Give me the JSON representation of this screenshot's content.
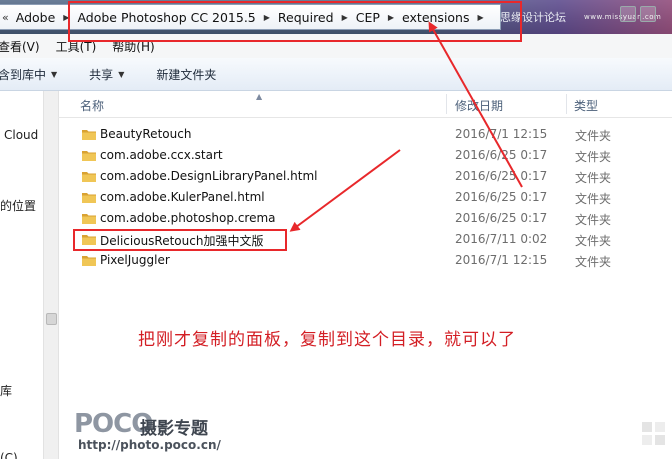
{
  "address_bar": {
    "lead": "«",
    "crumbs": [
      "Adobe",
      "Adobe Photoshop CC 2015.5",
      "Required",
      "CEP",
      "extensions"
    ],
    "watermark": "思缘设计论坛",
    "watermark_url": "www.missyuan.com"
  },
  "menu": {
    "items": [
      "查看(V)",
      "工具(T)",
      "帮助(H)"
    ]
  },
  "toolbar": {
    "items": [
      "含到库中",
      "共享",
      "新建文件夹"
    ]
  },
  "nav_pane": {
    "labels": [
      "Cloud",
      "的位置",
      "库",
      "(C)"
    ]
  },
  "columns": {
    "name": "名称",
    "modified": "修改日期",
    "type": "类型"
  },
  "files": [
    {
      "name": "BeautyRetouch",
      "date": "2016/7/1 12:15",
      "type": "文件夹"
    },
    {
      "name": "com.adobe.ccx.start",
      "date": "2016/6/25 0:17",
      "type": "文件夹"
    },
    {
      "name": "com.adobe.DesignLibraryPanel.html",
      "date": "2016/6/25 0:17",
      "type": "文件夹"
    },
    {
      "name": "com.adobe.KulerPanel.html",
      "date": "2016/6/25 0:17",
      "type": "文件夹"
    },
    {
      "name": "com.adobe.photoshop.crema",
      "date": "2016/6/25 0:17",
      "type": "文件夹"
    },
    {
      "name": "DeliciousRetouch加强中文版",
      "date": "2016/7/11 0:02",
      "type": "文件夹"
    },
    {
      "name": "PixelJuggler",
      "date": "2016/7/1 12:15",
      "type": "文件夹"
    }
  ],
  "annotation": {
    "text": "把刚才复制的面板，复制到这个目录，就可以了",
    "color": "#d31e24"
  },
  "watermark_bottom": {
    "logo": "POCO",
    "title": "摄影专题",
    "url": "http://photo.poco.cn/"
  },
  "colors": {
    "folder": "#e9b949",
    "header_text": "#4c607a",
    "highlight_box": "#e8282b"
  }
}
